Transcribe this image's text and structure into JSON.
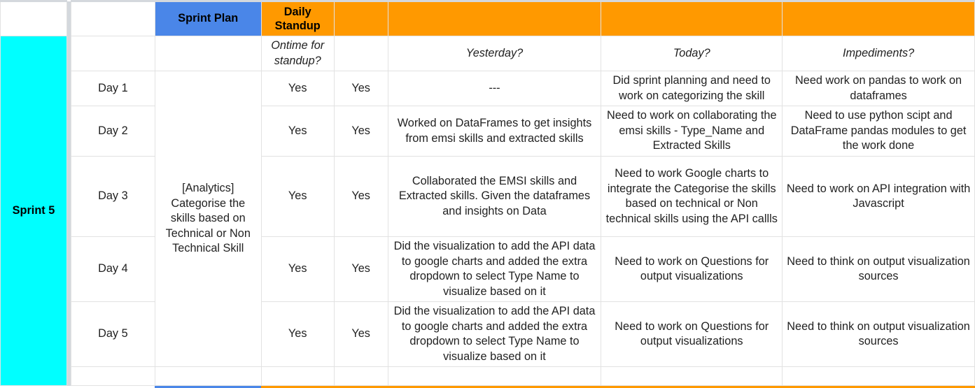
{
  "header": {
    "sprint_plan": "Sprint Plan",
    "daily_standup": "Daily Standup"
  },
  "subheader": {
    "ontime": "Ontime for standup?",
    "yesterday": "Yesterday?",
    "today": "Today?",
    "impediments": "Impediments?"
  },
  "sprint": {
    "label": "Sprint 5",
    "plan": "[Analytics] Categorise the skills based on Technical or Non Technical Skill"
  },
  "rows": [
    {
      "day": "Day 1",
      "ontime": "Yes",
      "attended": "Yes",
      "yesterday": "---",
      "today": "Did sprint planning and need to work on categorizing the skill",
      "impediments": "Need work on pandas to work on dataframes"
    },
    {
      "day": "Day 2",
      "ontime": "Yes",
      "attended": "Yes",
      "yesterday": "Worked on DataFrames to get insights from emsi skills and extracted skills",
      "today": "Need to work on collaborating the emsi skills - Type_Name and Extracted Skills",
      "impediments": "Need to use python scipt and DataFrame pandas modules to get the work done"
    },
    {
      "day": "Day 3",
      "ontime": "Yes",
      "attended": "Yes",
      "yesterday": "Collaborated the EMSI skills and Extracted skills. Given the dataframes and insights on Data",
      "today": "Need to work Google charts to integrate the Categorise the skills based on technical or Non technical skills using the API callls",
      "impediments": "Need to work on API integration with Javascript"
    },
    {
      "day": "Day 4",
      "ontime": "Yes",
      "attended": "Yes",
      "yesterday": "Did the visualization to add the API data to google charts and added the extra dropdown to select Type Name to visualize based on it",
      "today": "Need to work on Questions for output visualizations",
      "impediments": "Need to think on output visualization sources"
    },
    {
      "day": "Day 5",
      "ontime": "Yes",
      "attended": "Yes",
      "yesterday": "Did the visualization to add the API data to google charts and added the extra dropdown to select Type Name to visualize based on it",
      "today": "Need to work on Questions for output visualizations",
      "impediments": "Need to think on output visualization sources"
    }
  ],
  "colors": {
    "sprint_plan_header": "#4a86e8",
    "standup_header": "#ff9900",
    "sprint_cell": "#00ffff"
  }
}
